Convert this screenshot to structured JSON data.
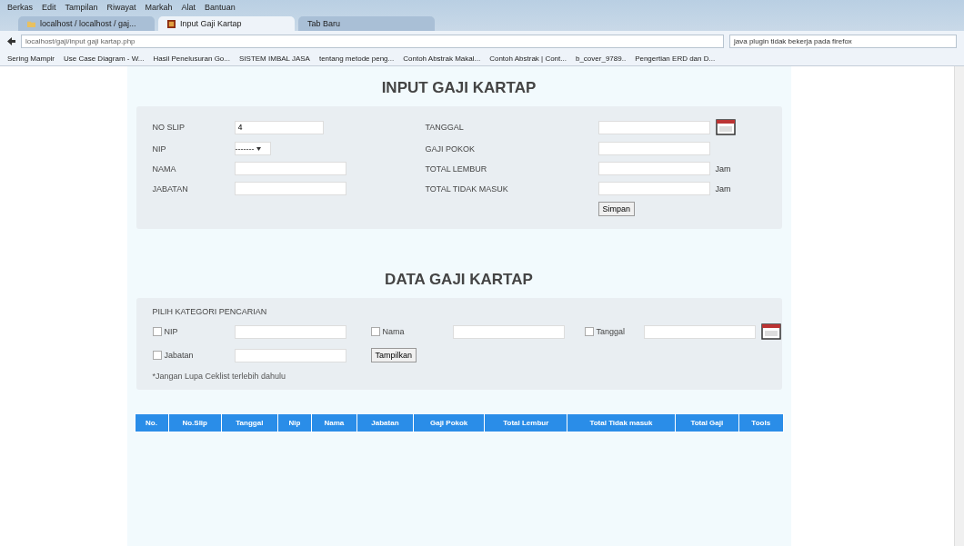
{
  "menu": [
    "Berkas",
    "Edit",
    "Tampilan",
    "Riwayat",
    "Markah",
    "Alat",
    "Bantuan"
  ],
  "tabs": [
    {
      "label": "localhost / localhost / gaj...",
      "selected": false,
      "kind": "folder"
    },
    {
      "label": "Input Gaji Kartap",
      "selected": true,
      "kind": "site"
    },
    {
      "label": "Tab Baru",
      "selected": false,
      "kind": "blank"
    }
  ],
  "address": {
    "value": "localhost/gaji/input gaji kartap.php"
  },
  "search": {
    "value": "java plugin tidak bekerja pada firefox"
  },
  "bookmarks": [
    "Sering Mampir",
    "Use Case Diagram - W...",
    "Hasil Penelusuran Go...",
    "SISTEM IMBAL JASA",
    "tentang metode peng...",
    "Contoh Abstrak Makal...",
    "Contoh Abstrak | Cont...",
    "b_cover_9789..",
    "Pengertian ERD dan D..."
  ],
  "input_title": "INPUT GAJI KARTAP",
  "form_left": [
    {
      "label": "NO SLIP",
      "kind": "text",
      "value": "4"
    },
    {
      "label": "NIP",
      "kind": "select",
      "value": "-------"
    },
    {
      "label": "NAMA",
      "kind": "text"
    },
    {
      "label": "JABATAN",
      "kind": "text"
    }
  ],
  "form_right": [
    {
      "label": "TANGGAL",
      "kind": "date"
    },
    {
      "label": "GAJI POKOK",
      "kind": "text"
    },
    {
      "label": "TOTAL LEMBUR",
      "kind": "text",
      "unit": "Jam"
    },
    {
      "label": "TOTAL TIDAK MASUK",
      "kind": "text",
      "unit": "Jam"
    }
  ],
  "save_button": "Simpan",
  "data_title": "DATA GAJI KARTAP",
  "search_panel": {
    "heading": "PILIH KATEGORI PENCARIAN",
    "filters": [
      {
        "label": "NIP",
        "checked": false,
        "kind": "text"
      },
      {
        "label": "Nama",
        "checked": false,
        "kind": "text"
      },
      {
        "label": "Tanggal",
        "checked": false,
        "kind": "date"
      },
      {
        "label": "Jabatan",
        "checked": false,
        "kind": "text"
      }
    ],
    "button": "Tampilkan",
    "note": "*Jangan Lupa Ceklist terlebih dahulu"
  },
  "table": {
    "columns": [
      "No.",
      "No.Slip",
      "Tanggal",
      "Nip",
      "Nama",
      "Jabatan",
      "Gaji Pokok",
      "Total Lembur",
      "Total Tidak masuk",
      "Total Gaji",
      "Tools"
    ]
  }
}
